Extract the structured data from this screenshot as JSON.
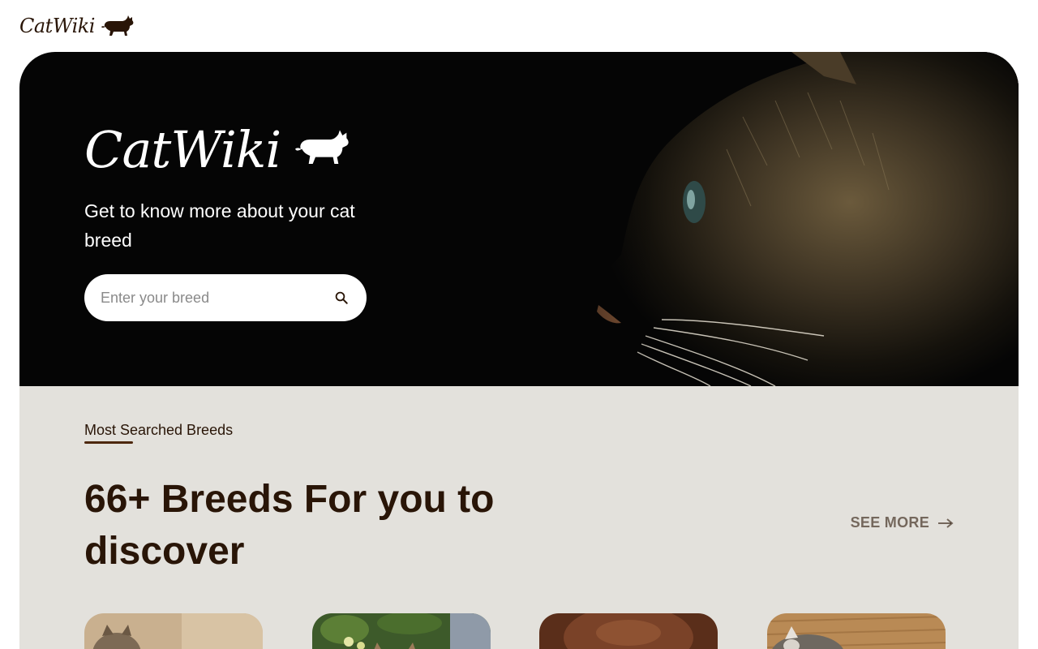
{
  "header": {
    "logo_text": "CatWiki",
    "logo_icon": "cat-silhouette-icon"
  },
  "hero": {
    "logo_text": "CatWiki",
    "tagline": "Get to know more about your cat breed",
    "search": {
      "placeholder": "Enter your breed",
      "value": "",
      "icon": "search-icon"
    },
    "photo": "cat-profile-photo"
  },
  "breeds_section": {
    "label": "Most Searched Breeds",
    "heading": "66+ Breeds For you to discover",
    "see_more_label": "SEE MORE",
    "see_more_icon": "arrow-right-icon",
    "cards": [
      "breed-card-photo-1",
      "breed-card-photo-2",
      "breed-card-photo-3",
      "breed-card-photo-4"
    ]
  },
  "colors": {
    "brand_brown": "#291507",
    "hero_bg": "#050505",
    "section_bg": "#e3e1dc",
    "white": "#ffffff"
  }
}
